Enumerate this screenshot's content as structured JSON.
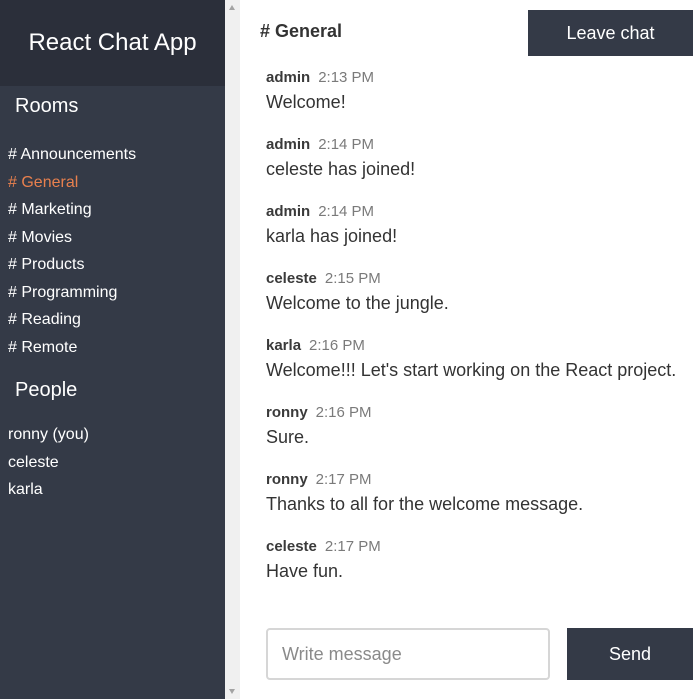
{
  "app": {
    "title": "React Chat App"
  },
  "sidebar": {
    "rooms_heading": "Rooms",
    "rooms": [
      {
        "label": "# Announcements",
        "active": false
      },
      {
        "label": "# General",
        "active": true
      },
      {
        "label": "# Marketing",
        "active": false
      },
      {
        "label": "# Movies",
        "active": false
      },
      {
        "label": "# Products",
        "active": false
      },
      {
        "label": "# Programming",
        "active": false
      },
      {
        "label": "# Reading",
        "active": false
      },
      {
        "label": "# Remote",
        "active": false
      }
    ],
    "people_heading": "People",
    "people": [
      {
        "name": "ronny (you)"
      },
      {
        "name": "celeste"
      },
      {
        "name": "karla"
      }
    ]
  },
  "chat": {
    "channel_title": "# General",
    "leave_label": "Leave chat",
    "messages": [
      {
        "user": "admin",
        "time": "2:13 PM",
        "text": "Welcome!"
      },
      {
        "user": "admin",
        "time": "2:14 PM",
        "text": "celeste has joined!"
      },
      {
        "user": "admin",
        "time": "2:14 PM",
        "text": "karla has joined!"
      },
      {
        "user": "celeste",
        "time": "2:15 PM",
        "text": "Welcome to the jungle."
      },
      {
        "user": "karla",
        "time": "2:16 PM",
        "text": "Welcome!!! Let's start working on the React project."
      },
      {
        "user": "ronny",
        "time": "2:16 PM",
        "text": "Sure."
      },
      {
        "user": "ronny",
        "time": "2:17 PM",
        "text": "Thanks to all for the welcome message."
      },
      {
        "user": "celeste",
        "time": "2:17 PM",
        "text": "Have fun."
      }
    ],
    "input": {
      "placeholder": "Write message",
      "value": ""
    },
    "send_label": "Send"
  },
  "colors": {
    "sidebar_bg": "#343a47",
    "header_bg": "#2b2f3a",
    "active_room": "#e8804e",
    "button_bg": "#343a47"
  }
}
